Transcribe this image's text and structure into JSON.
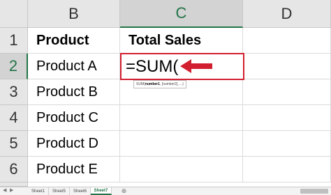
{
  "columns": [
    {
      "id": "col-b",
      "label": "B",
      "selected": false
    },
    {
      "id": "col-c",
      "label": "C",
      "selected": true
    },
    {
      "id": "col-d",
      "label": "D",
      "selected": false
    }
  ],
  "rows": [
    {
      "num": "1",
      "b": "Product",
      "c": "Total Sales"
    },
    {
      "num": "2",
      "b": "Product A",
      "c": "=SUM("
    },
    {
      "num": "3",
      "b": "Product B",
      "c": ""
    },
    {
      "num": "4",
      "b": "Product C",
      "c": ""
    },
    {
      "num": "5",
      "b": "Product D",
      "c": ""
    },
    {
      "num": "6",
      "b": "Product E",
      "c": ""
    }
  ],
  "tooltip": {
    "func": "SUM(",
    "arg1": "number1",
    "rest": ", [number2], ...)"
  },
  "sheets": [
    "Sheet1",
    "Sheet5",
    "Sheet6",
    "Sheet7"
  ],
  "active_sheet": "Sheet7",
  "colors": {
    "highlight": "#d11f2f",
    "excel_green": "#217346"
  }
}
